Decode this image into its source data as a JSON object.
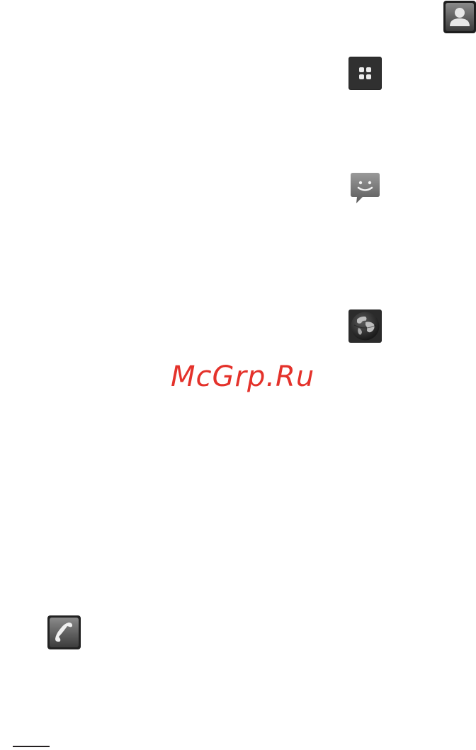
{
  "watermark": {
    "text": "McGrp.Ru",
    "color": "#e4322b"
  },
  "icons": [
    {
      "name": "contacts-icon"
    },
    {
      "name": "apps-icon"
    },
    {
      "name": "messaging-icon"
    },
    {
      "name": "browser-icon"
    },
    {
      "name": "phone-icon"
    }
  ],
  "colors": {
    "icon_background": "#2a2a2a",
    "icon_glyph": "#e6e6e6",
    "footnote_rule": "#231f20"
  }
}
